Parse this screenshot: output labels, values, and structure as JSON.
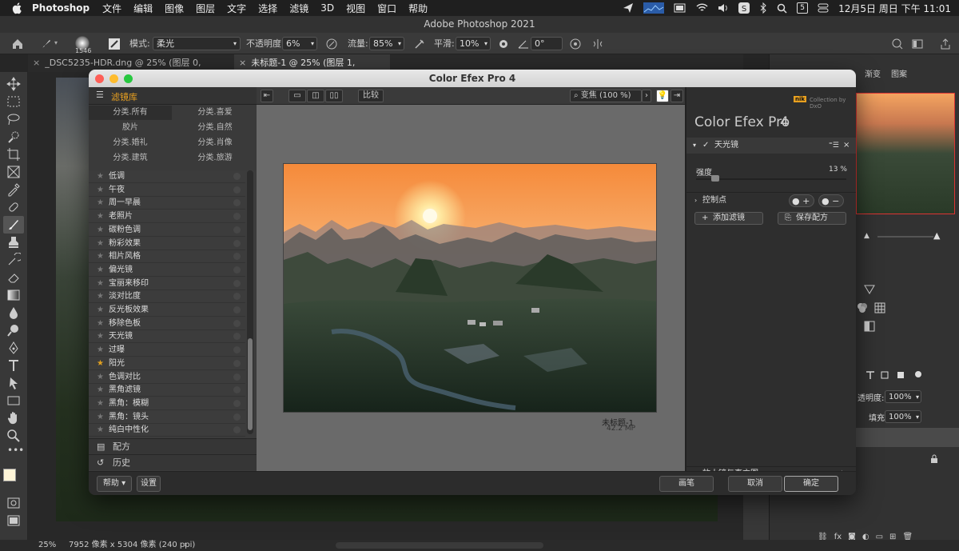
{
  "menubar": {
    "app": "Photoshop",
    "items": [
      "文件",
      "编辑",
      "图像",
      "图层",
      "文字",
      "选择",
      "滤镜",
      "3D",
      "视图",
      "窗口",
      "帮助"
    ],
    "clock": "12月5日 周日 下午 11:01",
    "date_badge": "5"
  },
  "ps_title": "Adobe Photoshop 2021",
  "options": {
    "brush_size": "1546",
    "mode_label": "模式:",
    "mode_value": "柔光",
    "opacity_label": "不透明度:",
    "opacity_value": "6%",
    "flow_label": "流量:",
    "flow_value": "85%",
    "smooth_label": "平滑:",
    "smooth_value": "10%",
    "angle_value": "0°"
  },
  "tabs": [
    {
      "label": "_DSC5235-HDR.dng @ 25% (图层 0, RGB/16*) *"
    },
    {
      "label": "未标题-1 @ 25% (图层 1, RGB/16*) *"
    }
  ],
  "right_panel": {
    "tab_gradient": "渐变",
    "tab_pattern": "图案",
    "opacity_label": "透明度:",
    "opacity_value": "100%",
    "fill_label": "填充:",
    "fill_value": "100%"
  },
  "status": {
    "zoom": "25%",
    "info": "7952 像素 x 5304 像素 (240 ppi)"
  },
  "cefx": {
    "title": "Color Efex Pro 4",
    "filter_library": "滤镜库",
    "categories": [
      "分类.所有",
      "分类.喜爱",
      "胶片",
      "分类.自然",
      "分类.婚礼",
      "分类.肖像",
      "分类.建筑",
      "分类.旅游"
    ],
    "filters": [
      {
        "name": "低调",
        "fav": false
      },
      {
        "name": "午夜",
        "fav": false
      },
      {
        "name": "周一早晨",
        "fav": false
      },
      {
        "name": "老照片",
        "fav": false
      },
      {
        "name": "碳粉色调",
        "fav": false
      },
      {
        "name": "粉彩效果",
        "fav": false
      },
      {
        "name": "相片风格",
        "fav": false
      },
      {
        "name": "偏光镜",
        "fav": false
      },
      {
        "name": "宝丽来移印",
        "fav": false
      },
      {
        "name": "淡对比度",
        "fav": false
      },
      {
        "name": "反光板效果",
        "fav": false
      },
      {
        "name": "移除色板",
        "fav": false
      },
      {
        "name": "天光镜",
        "fav": false
      },
      {
        "name": "过曝",
        "fav": false
      },
      {
        "name": "阳光",
        "fav": true
      },
      {
        "name": "色调对比",
        "fav": false
      },
      {
        "name": "黑角滤镜",
        "fav": false
      },
      {
        "name": "黑角：模糊",
        "fav": false
      },
      {
        "name": "黑角：镜头",
        "fav": false
      },
      {
        "name": "纯白中性化",
        "fav": false
      }
    ],
    "recipes": "配方",
    "history": "历史",
    "compare": "比较",
    "zoom": "变焦 (100 %)",
    "image_name": "未标题-1",
    "image_mp": "42.2 MP",
    "brand_small": "Collection by DxO",
    "brand_badge": "nik",
    "right_title": "Color Efex Pro",
    "right_title_num": "4",
    "active_filter": "天光镜",
    "strength_label": "强度",
    "strength_value": "13 %",
    "strength_fraction": 0.13,
    "control_points": "控制点",
    "add_filter": "添加滤镜",
    "save_recipe": "保存配方",
    "loupe": "放大镜与直方图",
    "btn_help": "帮助",
    "btn_settings": "设置",
    "btn_brush": "画笔",
    "btn_cancel": "取消",
    "btn_ok": "确定"
  }
}
